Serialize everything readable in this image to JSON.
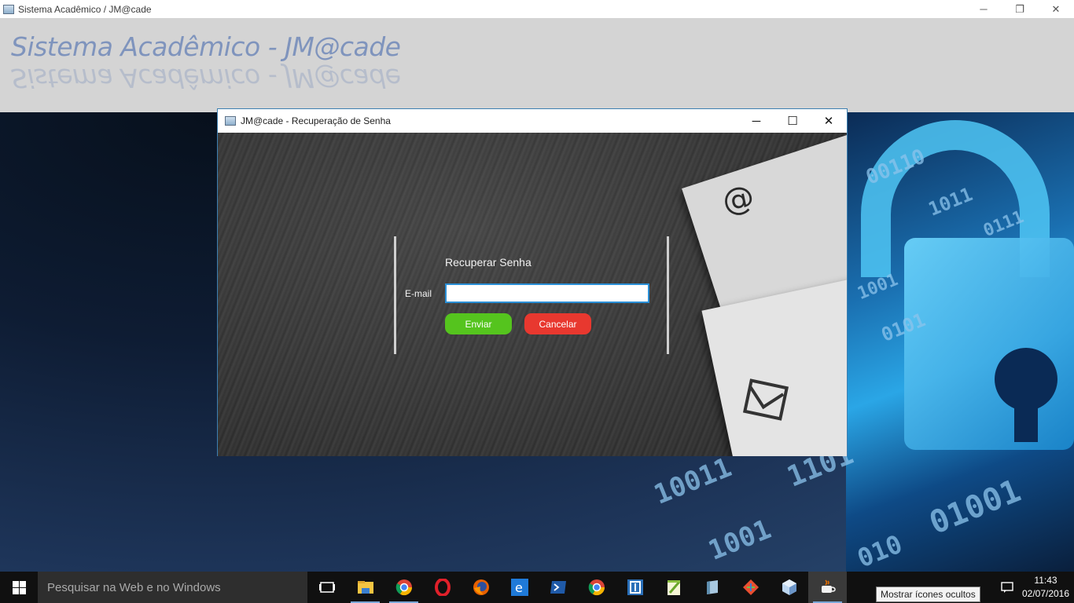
{
  "window": {
    "title": "Sistema Acadêmico / JM@cade",
    "controls": {
      "minimize": "─",
      "restore": "❐",
      "close": "✕"
    }
  },
  "banner": {
    "logo_text": "Sistema Acadêmico - JM@cade",
    "logo_color": "#7f94bd"
  },
  "dialog": {
    "title": "JM@cade - Recuperação de Senha",
    "controls": {
      "minimize": "─",
      "maximize": "☐",
      "close": "✕"
    },
    "form_title": "Recuperar Senha",
    "email_label": "E-mail",
    "email_value": "",
    "send_label": "Enviar",
    "cancel_label": "Cancelar",
    "send_color": "#55c41e",
    "cancel_color": "#e8382f",
    "decor": {
      "at_symbol": "@"
    }
  },
  "desktop": {
    "binary_texts": [
      "00110",
      "1011",
      "0111",
      "1001",
      "0101",
      "10011",
      "1101",
      "01001",
      "1001",
      "010"
    ]
  },
  "taskbar": {
    "search_placeholder": "Pesquisar na Web e no Windows",
    "apps": [
      {
        "name": "task-view-icon"
      },
      {
        "name": "file-explorer-icon"
      },
      {
        "name": "chrome-icon"
      },
      {
        "name": "opera-icon"
      },
      {
        "name": "firefox-icon"
      },
      {
        "name": "edge-icon"
      },
      {
        "name": "powershell-icon"
      },
      {
        "name": "chrome-alt-icon"
      },
      {
        "name": "app-blue-icon"
      },
      {
        "name": "notepad-plus-icon"
      },
      {
        "name": "app-notebook-icon"
      },
      {
        "name": "git-icon"
      },
      {
        "name": "virtualbox-icon"
      },
      {
        "name": "java-icon"
      }
    ],
    "tooltip": "Mostrar ícones ocultos",
    "clock_time": "11:43",
    "clock_date": "02/07/2016"
  }
}
